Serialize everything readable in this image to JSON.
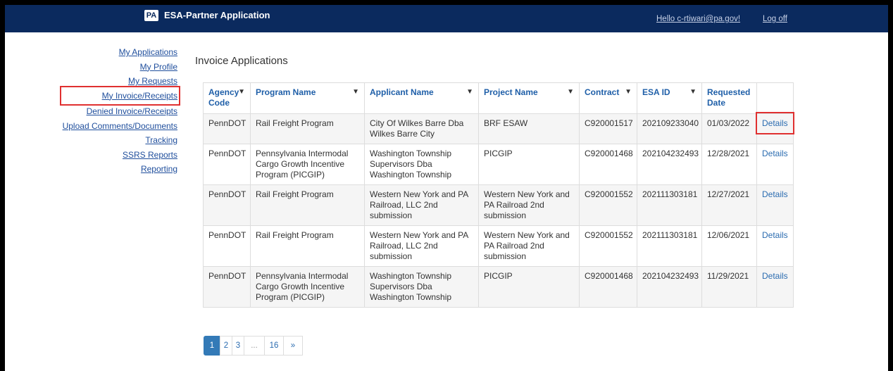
{
  "header": {
    "logo_text": "PA",
    "title": "ESA-Partner Application",
    "user_greeting": "Hello c-rtiwari@pa.gov!",
    "logoff": "Log off"
  },
  "sidebar": {
    "items": [
      {
        "label": "My Applications"
      },
      {
        "label": "My Profile"
      },
      {
        "label": "My Requests"
      },
      {
        "label": "My Invoice/Receipts",
        "highlighted": true
      },
      {
        "label": "Denied Invoice/Receipts"
      },
      {
        "label": "Upload Comments/Documents"
      },
      {
        "label": "Tracking"
      },
      {
        "label": "SSRS Reports"
      },
      {
        "label": "Reporting"
      }
    ]
  },
  "main": {
    "title": "Invoice Applications",
    "columns": [
      {
        "label": "Agency Code",
        "filter": true
      },
      {
        "label": "Program Name",
        "filter": true
      },
      {
        "label": "Applicant Name",
        "filter": true
      },
      {
        "label": "Project Name",
        "filter": true
      },
      {
        "label": "Contract",
        "filter": true
      },
      {
        "label": "ESA ID",
        "filter": true
      },
      {
        "label": "Requested Date",
        "filter": false
      },
      {
        "label": "",
        "filter": false
      }
    ],
    "filter_icon": "funnel-icon",
    "rows": [
      [
        "PennDOT",
        "Rail Freight Program",
        "City Of Wilkes Barre Dba Wilkes Barre City",
        "BRF ESAW",
        "C920001517",
        "202109233040",
        "01/03/2022",
        "Details"
      ],
      [
        "PennDOT",
        "Pennsylvania Intermodal Cargo Growth Incentive Program (PICGIP)",
        "Washington Township Supervisors Dba Washington Township",
        "PICGIP",
        "C920001468",
        "202104232493",
        "12/28/2021",
        "Details"
      ],
      [
        "PennDOT",
        "Rail Freight Program",
        "Western New York and PA Railroad, LLC 2nd submission",
        "Western New York and PA Railroad 2nd submission",
        "C920001552",
        "202111303181",
        "12/27/2021",
        "Details"
      ],
      [
        "PennDOT",
        "Rail Freight Program",
        "Western New York and PA Railroad, LLC 2nd submission",
        "Western New York and PA Railroad 2nd submission",
        "C920001552",
        "202111303181",
        "12/06/2021",
        "Details"
      ],
      [
        "PennDOT",
        "Pennsylvania Intermodal Cargo Growth Incentive Program (PICGIP)",
        "Washington Township Supervisors Dba Washington Township",
        "PICGIP",
        "C920001468",
        "202104232493",
        "11/29/2021",
        "Details"
      ]
    ]
  },
  "pagination": {
    "pages": [
      "1",
      "2",
      "3",
      "...",
      "16",
      "»"
    ],
    "active": "1"
  },
  "colors": {
    "header_bg": "#0b2a5e",
    "link": "#2b6cb0",
    "highlight": "#e03030",
    "active_page": "#337ab7"
  }
}
